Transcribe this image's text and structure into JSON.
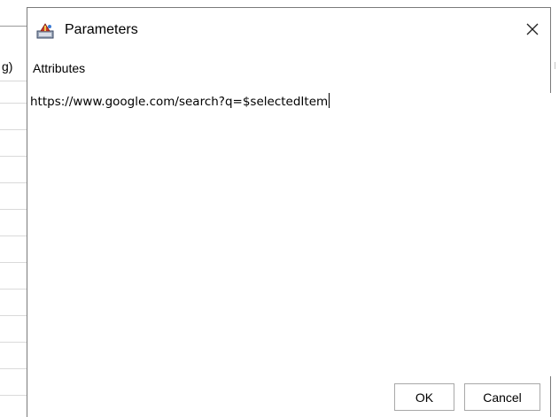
{
  "background_app": {
    "column_header_fragment": "g)"
  },
  "dialog": {
    "title": "Parameters",
    "icons": {
      "app": "app-icon",
      "close": "close-icon"
    },
    "field_label": "Attributes",
    "field_value": "https://www.google.com/search?q=$selectedItem",
    "buttons": {
      "ok_label": "OK",
      "cancel_label": "Cancel"
    }
  }
}
